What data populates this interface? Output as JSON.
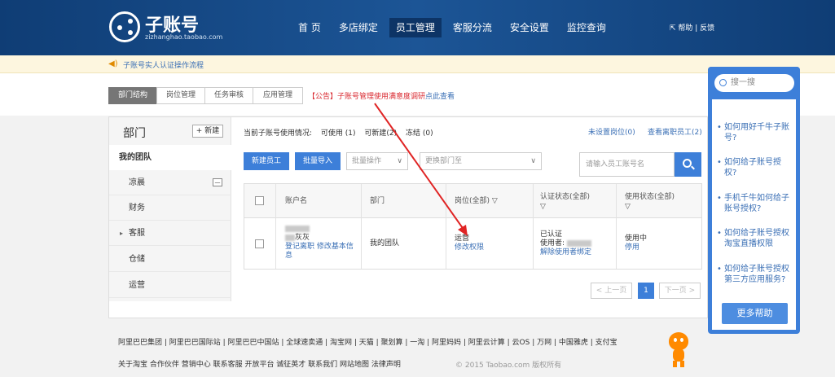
{
  "header": {
    "logo_title": "子账号",
    "logo_subtitle": "zizhanghao.taobao.com",
    "nav": [
      "首 页",
      "多店绑定",
      "员工管理",
      "客服分流",
      "安全设置",
      "监控查询"
    ],
    "active_nav": "员工管理",
    "help_links": "帮助 | 反馈"
  },
  "notice": {
    "text": "子账号实人认证操作流程"
  },
  "tabs": [
    "部门结构",
    "岗位管理",
    "任务审核",
    "应用管理"
  ],
  "announcement": {
    "prefix": "【公告】子账号管理使用满意度调研",
    "link": "点此查看"
  },
  "department": {
    "title": "部门",
    "new_button": "+ 新建",
    "team": "我的团队",
    "items": [
      "凉晨",
      "财务",
      "客服",
      "仓储",
      "运营"
    ]
  },
  "status": {
    "label": "当前子账号使用情况:",
    "used": "可使用 (1)",
    "new": "可新建(2)",
    "frozen": "冻结 (0)",
    "no_position": "未设置岗位(0)",
    "resigned": "查看离职员工(2)"
  },
  "toolbar": {
    "new_employee": "新建员工",
    "bulk_import": "批量导入",
    "bulk_ops": "批量操作",
    "change_dept": "更换部门至",
    "search_placeholder": "请输入员工账号名"
  },
  "table": {
    "headers": {
      "account": "账户名",
      "dept": "部门",
      "position": "岗位(全部)",
      "auth": "认证状态(全部)",
      "usage": "使用状态(全部)"
    },
    "rows": [
      {
        "account_name": "灰灰",
        "account_actions": "登记离职 修改基本信息",
        "dept": "我的团队",
        "position": "运营",
        "position_action": "修改权限",
        "auth_status": "已认证",
        "auth_user": "使用者:",
        "auth_action": "解除使用者绑定",
        "usage_status": "使用中",
        "usage_action": "停用"
      }
    ]
  },
  "pager": {
    "prev": "< 上一页",
    "current": "1",
    "next": "下一页 >"
  },
  "footer": {
    "links1": "阿里巴巴集团 | 阿里巴巴国际站 | 阿里巴巴中国站 | 全球速卖通 | 淘宝网 | 天猫 | 聚划算 | 一淘 | 阿里妈妈 | 阿里云计算 | 云OS | 万网 | 中国雅虎 | 支付宝",
    "links2": "关于淘宝 合作伙伴 营销中心 联系客服 开放平台 诚征英才 联系我们 网站地图 法律声明",
    "copyright": "© 2015 Taobao.com 版权所有"
  },
  "help_panel": {
    "search_placeholder": "搜一搜",
    "items": [
      "如何用好千牛子账号?",
      "如何给子账号授权?",
      "手机千牛如何给子账号授权?",
      "如何给子账号授权淘宝直播权限",
      "如何给子账号授权第三方应用服务?"
    ],
    "more": "更多帮助"
  },
  "colors": {
    "header_bg": "#1a4f8a",
    "accent": "#3d7fd9",
    "link": "#3a6fb5",
    "alert_red": "#d9282f"
  }
}
